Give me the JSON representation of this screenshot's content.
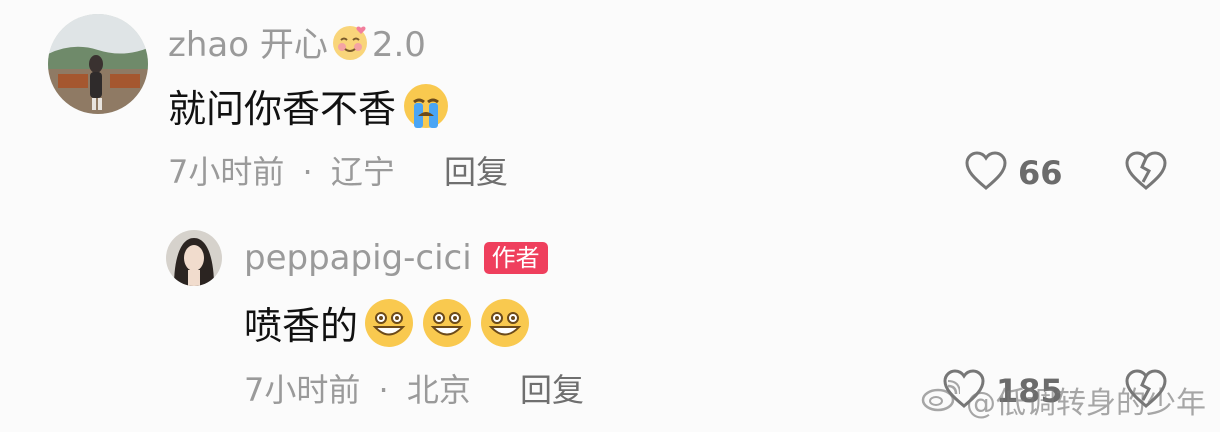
{
  "colors": {
    "badge_bg": "#ef3f5d",
    "meta_text": "#9a9a9a",
    "content_text": "#111111"
  },
  "comments": [
    {
      "username": "zhao 开心",
      "username_suffix": "2.0",
      "username_emoji_icon": "smiling-face-with-hearts-icon",
      "content": "就问你香不香",
      "content_emoji_icons": [
        "crying-face-icon"
      ],
      "time": "7小时前",
      "separator": "·",
      "location": "辽宁",
      "reply_label": "回复",
      "like_count": "66"
    },
    {
      "username": "peppapig-cici",
      "badge": "作者",
      "content": "喷香的",
      "content_emoji_icons": [
        "grinning-face-icon",
        "grinning-face-icon",
        "grinning-face-icon"
      ],
      "time": "7小时前",
      "separator": "·",
      "location": "北京",
      "reply_label": "回复",
      "like_count": "185"
    }
  ],
  "watermark": {
    "icon": "weibo-icon",
    "text": "@低调转身的少年"
  }
}
